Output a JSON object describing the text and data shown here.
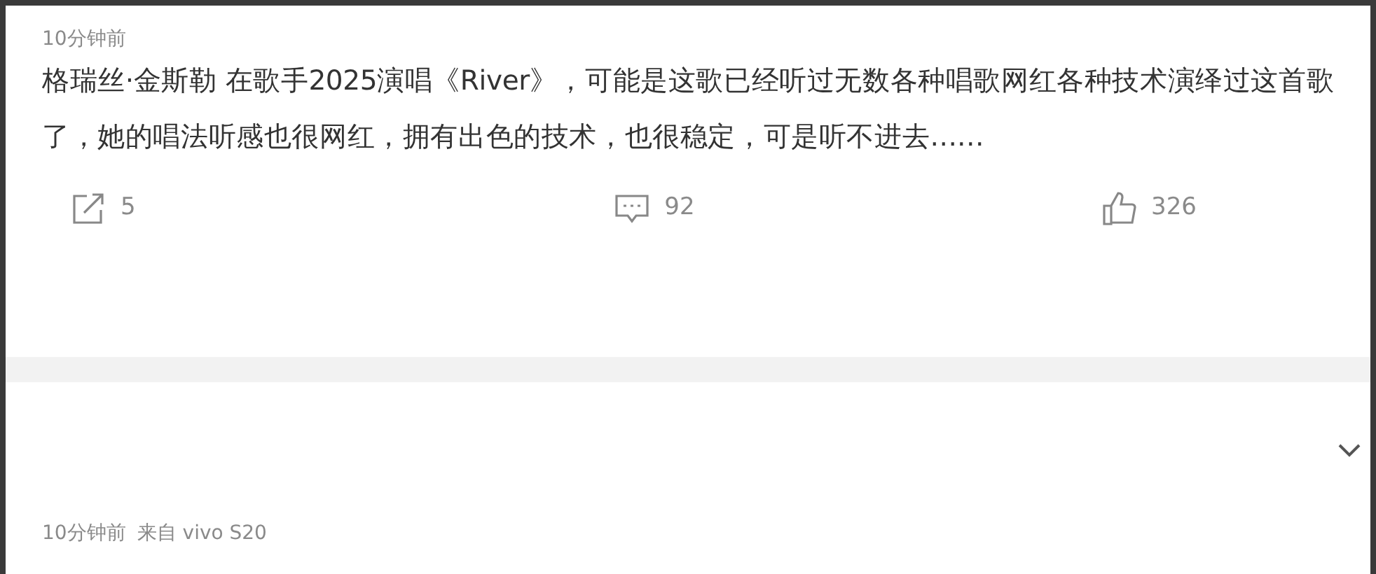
{
  "posts": [
    {
      "time": "10分钟前",
      "text": "格瑞丝·金斯勒 在歌手2025演唱《River》，可能是这歌已经听过无数各种唱歌网红各种技术演绎过这首歌了，她的唱法听感也很网红，拥有出色的技术，也很稳定，可是听不进去……",
      "actions": [
        {
          "kind": "share",
          "count": "5"
        },
        {
          "kind": "comment",
          "count": "92"
        },
        {
          "kind": "like",
          "count": "326"
        }
      ]
    },
    {
      "time": "10分钟前",
      "source": "来自 vivo S20",
      "collapsible": true
    }
  ]
}
